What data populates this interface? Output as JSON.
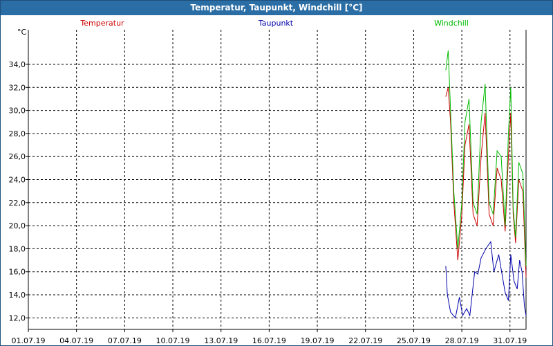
{
  "window": {
    "title": "Temperatur, Taupunkt, Windchill [°C]"
  },
  "chart_data": {
    "type": "line",
    "title": "Temperatur, Taupunkt, Windchill [°C]",
    "ylabel": "°C",
    "xlabel": "",
    "ylim": [
      11,
      37
    ],
    "xlim": [
      0,
      31
    ],
    "x_unit": "days since 01.07.19",
    "yticks": [
      12,
      14,
      16,
      18,
      20,
      22,
      24,
      26,
      28,
      30,
      32,
      34
    ],
    "ytick_labels": [
      "12,0",
      "14,0",
      "16,0",
      "18,0",
      "20,0",
      "22,0",
      "24,0",
      "26,0",
      "28,0",
      "30,0",
      "32,0",
      "34,0"
    ],
    "xticks": [
      0,
      3,
      6,
      9,
      12,
      15,
      18,
      21,
      24,
      27,
      30
    ],
    "xtick_labels": [
      "01.07.19",
      "04.07.19",
      "07.07.19",
      "10.07.19",
      "13.07.19",
      "16.07.19",
      "19.07.19",
      "22.07.19",
      "25.07.19",
      "28.07.19",
      "31.07.19"
    ],
    "grid": true,
    "legend_position": "top",
    "series": [
      {
        "name": "Temperatur",
        "color": "#cc0000",
        "x": [
          26.0,
          26.15,
          26.3,
          26.5,
          26.75,
          27.0,
          27.2,
          27.45,
          27.7,
          27.95,
          28.2,
          28.45,
          28.7,
          28.95,
          29.2,
          29.45,
          29.7,
          29.9,
          30.05,
          30.2,
          30.35,
          30.55,
          30.8,
          31.0
        ],
        "values": [
          31.2,
          32.0,
          29.0,
          22.0,
          17.0,
          21.0,
          27.0,
          28.8,
          21.0,
          20.0,
          26.0,
          29.8,
          21.0,
          20.0,
          25.0,
          24.0,
          19.5,
          26.0,
          29.8,
          21.0,
          18.5,
          24.0,
          23.0,
          15.5
        ]
      },
      {
        "name": "Taupunkt",
        "color": "#0000aa",
        "x": [
          26.0,
          26.1,
          26.3,
          26.6,
          26.85,
          27.05,
          27.3,
          27.5,
          27.8,
          28.0,
          28.2,
          28.5,
          28.8,
          29.0,
          29.3,
          29.5,
          29.7,
          29.9,
          30.05,
          30.25,
          30.45,
          30.6,
          30.75,
          30.9,
          31.0
        ],
        "values": [
          16.5,
          14.0,
          12.5,
          12.0,
          13.8,
          12.2,
          12.8,
          12.2,
          16.0,
          15.8,
          17.2,
          18.0,
          18.6,
          16.0,
          17.5,
          15.8,
          14.2,
          13.5,
          17.5,
          15.2,
          14.5,
          17.0,
          16.0,
          13.0,
          12.2
        ]
      },
      {
        "name": "Windchill",
        "color": "#00bb00",
        "x": [
          26.0,
          26.15,
          26.3,
          26.5,
          26.75,
          27.0,
          27.2,
          27.45,
          27.7,
          27.95,
          28.2,
          28.45,
          28.7,
          28.95,
          29.2,
          29.45,
          29.7,
          29.9,
          30.05,
          30.2,
          30.35,
          30.55,
          30.8,
          31.0
        ],
        "values": [
          33.5,
          35.2,
          30.0,
          23.0,
          18.0,
          22.0,
          29.0,
          31.0,
          22.0,
          21.0,
          29.0,
          32.3,
          22.0,
          21.0,
          26.5,
          26.0,
          20.0,
          28.0,
          32.0,
          21.5,
          19.0,
          25.5,
          24.5,
          16.5
        ]
      }
    ]
  }
}
